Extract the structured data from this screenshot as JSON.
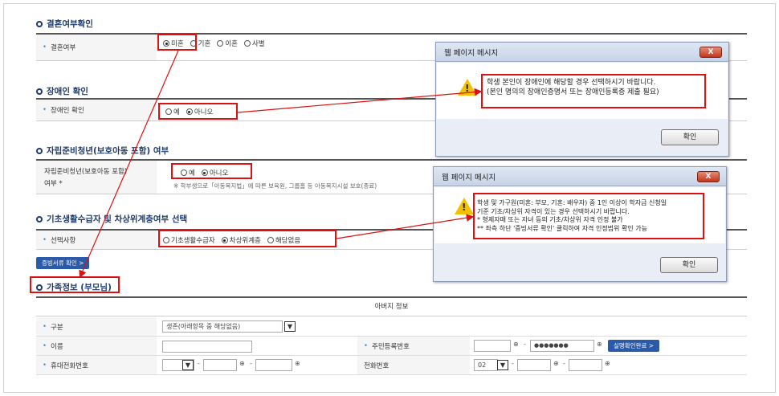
{
  "sections": {
    "marriage": {
      "title": "결혼여부확인",
      "label": "결혼여부",
      "options": [
        "미혼",
        "기혼",
        "이혼",
        "사별"
      ],
      "selected": "미혼"
    },
    "disability": {
      "title": "장애인 확인",
      "label": "장애인 확인",
      "options": [
        "예",
        "아니오"
      ],
      "selected": "아니오"
    },
    "youth": {
      "title": "자립준비청년(보호아동 포함) 여부",
      "label_line1": "자립준비청년(보호아동 포함)",
      "label_line2": "여부 *",
      "options": [
        "예",
        "아니오"
      ],
      "selected": "아니오",
      "note": "※ 학부생으로「아동복지법」에 따른 보육원, 그룹홈 등 아동복지시설 보호(종료)"
    },
    "welfare": {
      "title": "기초생활수급자 및 차상위계층여부 선택",
      "label": "선택사항",
      "options": [
        "기초생활수급자",
        "차상위계층",
        "해당없음"
      ],
      "selected": "차상위계층",
      "proof_button": "증빙서류 확인 >"
    },
    "family": {
      "title": "가족정보 (부모님)",
      "table_header": "아버지 정보",
      "rows": {
        "category_label": "구분",
        "category_value": "생존(아래항목 중 해당없음)",
        "name_label": "이름",
        "resident_label": "주민등록번호",
        "resident_masked": "●●●●●●●",
        "verify_button": "실명확인완료 >",
        "mobile_label": "휴대전화번호",
        "phone_label": "전화번호",
        "phone_prefix": "02",
        "dash": "-"
      }
    }
  },
  "dialogs": [
    {
      "title": "웹 페이지 메시지",
      "close": "X",
      "message_lines": [
        "학생 본인이 장애인에 해당할 경우 선택하시기 바랍니다.",
        "(본인 명의의 장애인증명서 또는 장애인등록증 제출 필요)"
      ],
      "ok_label": "확인"
    },
    {
      "title": "웹 페이지 메시지",
      "close": "X",
      "message_lines": [
        "학생 및 가구원(미혼: 부모, 기혼: 배우자) 중 1인 이상이 학자금 신청일",
        "기준 기초/차상위 자격이 있는 경우 선택하시기 바랍니다.",
        "* 형제자매 또는 자녀 등의 기초/차상위 자격 인정 불가",
        "** 좌측 하단 '증빙서류 확인' 클릭하여 자격 인정범위 확인 가능"
      ],
      "ok_label": "확인"
    }
  ],
  "colors": {
    "highlight": "#dd1111",
    "title_blue": "#1c3a6e",
    "button_blue": "#2a5aa8"
  }
}
